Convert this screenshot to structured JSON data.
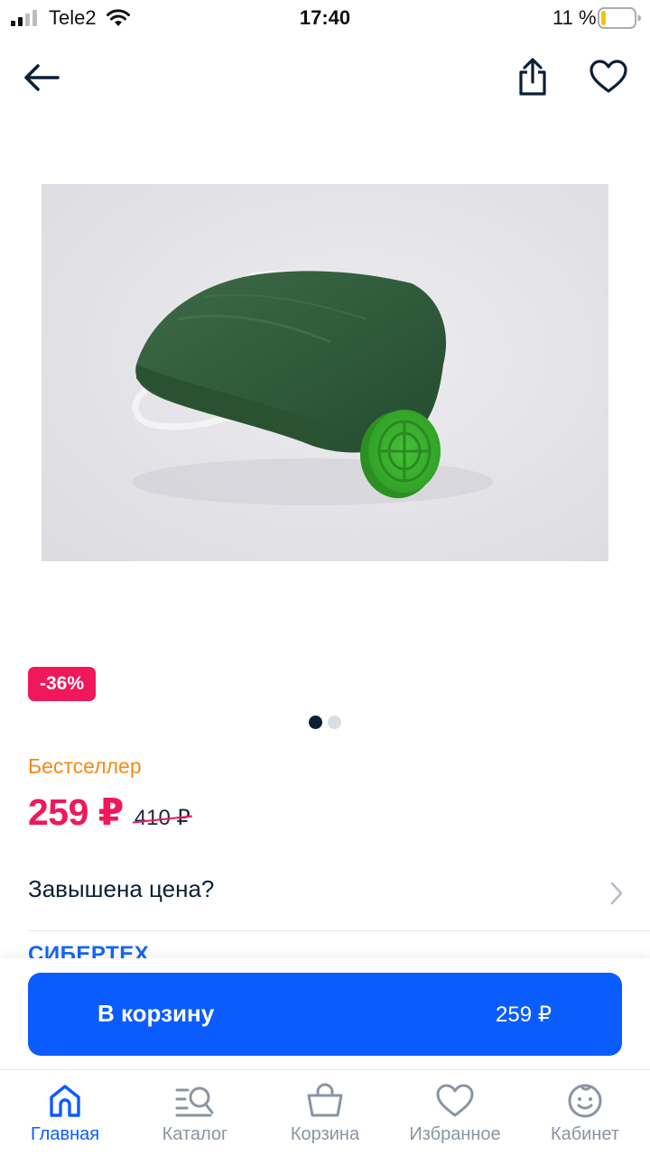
{
  "status_bar": {
    "carrier": "Tele2",
    "time": "17:40",
    "battery_percent": "11 %",
    "battery_level": 0.11,
    "icons": [
      "signal-icon",
      "wifi-icon",
      "battery-icon"
    ]
  },
  "header": {
    "icons": [
      "back-arrow-icon",
      "share-icon",
      "heart-icon"
    ]
  },
  "product": {
    "discount_badge": "-36%",
    "gallery": {
      "total": 2,
      "active": 1
    },
    "bestseller_label": "Бестселлер",
    "price": "259 ₽",
    "old_price": "410 ₽",
    "overprice_link": "Завышена цена?",
    "brand_peek": "СИБЕРТЕХ"
  },
  "cart": {
    "button_label": "В корзину",
    "button_price": "259 ₽"
  },
  "tabbar": {
    "items": [
      {
        "label": "Главная",
        "icon": "home-icon",
        "active": true
      },
      {
        "label": "Каталог",
        "icon": "catalog-search-icon",
        "active": false
      },
      {
        "label": "Корзина",
        "icon": "basket-icon",
        "active": false
      },
      {
        "label": "Избранное",
        "icon": "heart-outline-icon",
        "active": false
      },
      {
        "label": "Кабинет",
        "icon": "profile-face-icon",
        "active": false
      }
    ]
  },
  "colors": {
    "accent_blue": "#0b5cff",
    "sale_pink": "#f0185a",
    "bestseller_orange": "#f28a17",
    "text_dark": "#0b1f35",
    "tab_gray": "#8a94a3"
  }
}
